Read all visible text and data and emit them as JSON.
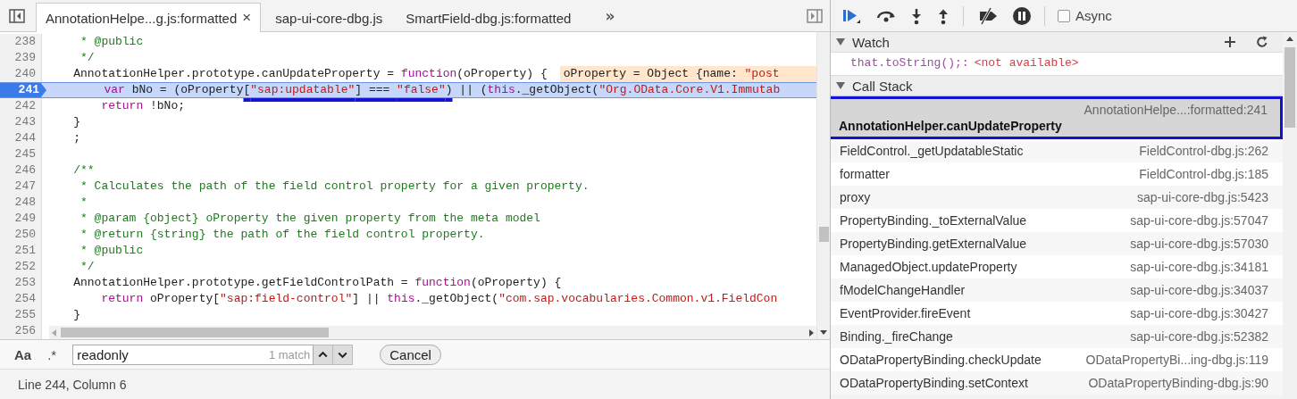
{
  "editor": {
    "tabs": [
      {
        "label": "AnnotationHelpe...g.js:formatted",
        "selected": true,
        "close": "×"
      },
      {
        "label": "sap-ui-core-dbg.js",
        "selected": false
      },
      {
        "label": "SmartField-dbg.js:formatted",
        "selected": false
      }
    ],
    "overflow": "»",
    "lines": [
      {
        "number": "238",
        "current": false,
        "tokens": [
          {
            "text": "     * @public",
            "kind": "comment"
          }
        ]
      },
      {
        "number": "239",
        "current": false,
        "tokens": [
          {
            "text": "     */",
            "kind": "comment"
          }
        ]
      },
      {
        "number": "240",
        "current": false,
        "tokens": [
          {
            "text": "    AnnotationHelper.prototype.canUpdateProperty = ",
            "kind": "plain"
          },
          {
            "text": "function",
            "kind": "keyword"
          },
          {
            "text": "(oProperty) {",
            "kind": "plain"
          }
        ],
        "inline_value": [
          {
            "text": "oProperty = Object {name: ",
            "kind": "plain"
          },
          {
            "text": "\"post",
            "kind": "string"
          }
        ]
      },
      {
        "number": "241",
        "current": true,
        "tokens": [
          {
            "text": "        var",
            "kind": "keyword",
            "marked": false
          },
          {
            "text": " bNo = (oProperty",
            "kind": "plain",
            "marked": false
          },
          {
            "text": "[",
            "kind": "plain",
            "marked": true
          },
          {
            "text": "\"sap:updatable\"",
            "kind": "string",
            "marked": true
          },
          {
            "text": "] === ",
            "kind": "plain",
            "marked": true
          },
          {
            "text": "\"false\"",
            "kind": "string",
            "marked": true
          },
          {
            "text": ")",
            "kind": "plain",
            "marked": true
          },
          {
            "text": " || (",
            "kind": "plain",
            "marked": false
          },
          {
            "text": "this",
            "kind": "keyword",
            "marked": false
          },
          {
            "text": "._getObject(",
            "kind": "plain",
            "marked": false
          },
          {
            "text": "\"Org.OData.Core.V1.Immutab",
            "kind": "string",
            "marked": false
          }
        ]
      },
      {
        "number": "242",
        "current": false,
        "tokens": [
          {
            "text": "        return",
            "kind": "keyword"
          },
          {
            "text": " !bNo;",
            "kind": "plain"
          }
        ]
      },
      {
        "number": "243",
        "current": false,
        "tokens": [
          {
            "text": "    }",
            "kind": "plain"
          }
        ]
      },
      {
        "number": "244",
        "current": false,
        "tokens": [
          {
            "text": "    ;",
            "kind": "plain"
          }
        ]
      },
      {
        "number": "245",
        "current": false
      },
      {
        "number": "246",
        "current": false,
        "tokens": [
          {
            "text": "    /**",
            "kind": "comment"
          }
        ]
      },
      {
        "number": "247",
        "current": false,
        "tokens": [
          {
            "text": "     * Calculates the path of the field control property for a given property.",
            "kind": "comment"
          }
        ]
      },
      {
        "number": "248",
        "current": false,
        "tokens": [
          {
            "text": "     *",
            "kind": "comment"
          }
        ]
      },
      {
        "number": "249",
        "current": false,
        "tokens": [
          {
            "text": "     * @param {object} oProperty the given property from the meta model",
            "kind": "comment"
          }
        ]
      },
      {
        "number": "250",
        "current": false,
        "tokens": [
          {
            "text": "     * @return {string} the path of the field control property.",
            "kind": "comment"
          }
        ]
      },
      {
        "number": "251",
        "current": false,
        "tokens": [
          {
            "text": "     * @public",
            "kind": "comment"
          }
        ]
      },
      {
        "number": "252",
        "current": false,
        "tokens": [
          {
            "text": "     */",
            "kind": "comment"
          }
        ]
      },
      {
        "number": "253",
        "current": false,
        "tokens": [
          {
            "text": "    AnnotationHelper.prototype.getFieldControlPath = ",
            "kind": "plain"
          },
          {
            "text": "function",
            "kind": "keyword"
          },
          {
            "text": "(oProperty) {",
            "kind": "plain"
          }
        ]
      },
      {
        "number": "254",
        "current": false,
        "tokens": [
          {
            "text": "        return",
            "kind": "keyword"
          },
          {
            "text": " oProperty[",
            "kind": "plain"
          },
          {
            "text": "\"sap:field-control\"",
            "kind": "string"
          },
          {
            "text": "] || ",
            "kind": "plain"
          },
          {
            "text": "this",
            "kind": "keyword"
          },
          {
            "text": "._getObject(",
            "kind": "plain"
          },
          {
            "text": "\"com.sap.vocabularies.Common.v1.FieldCon",
            "kind": "string"
          }
        ]
      },
      {
        "number": "255",
        "current": false,
        "tokens": [
          {
            "text": "    }",
            "kind": "plain"
          }
        ]
      },
      {
        "number": "256",
        "current": false
      }
    ]
  },
  "search": {
    "case_toggle": "Aa",
    "regex_toggle": ".*",
    "value": "readonly",
    "match_count": "1 match",
    "cancel": "Cancel"
  },
  "status_bar": "Line 244, Column 6",
  "debugger": {
    "async": {
      "label": "Async",
      "checked": false
    },
    "watch": {
      "title": "Watch",
      "expanded": true,
      "expressions": [
        {
          "expression": "that.toString();:",
          "value": "<not available>"
        }
      ]
    },
    "call_stack": {
      "title": "Call Stack",
      "expanded": true,
      "frames": [
        {
          "function": "AnnotationHelper.canUpdateProperty",
          "location": "AnnotationHelpe...:formatted:241",
          "selected": true
        },
        {
          "function": "FieldControl._getUpdatableStatic",
          "location": "FieldControl-dbg.js:262",
          "selected": false
        },
        {
          "function": "formatter",
          "location": "FieldControl-dbg.js:185",
          "selected": false
        },
        {
          "function": "proxy",
          "location": "sap-ui-core-dbg.js:5423",
          "selected": false
        },
        {
          "function": "PropertyBinding._toExternalValue",
          "location": "sap-ui-core-dbg.js:57047",
          "selected": false
        },
        {
          "function": "PropertyBinding.getExternalValue",
          "location": "sap-ui-core-dbg.js:57030",
          "selected": false
        },
        {
          "function": "ManagedObject.updateProperty",
          "location": "sap-ui-core-dbg.js:34181",
          "selected": false
        },
        {
          "function": "fModelChangeHandler",
          "location": "sap-ui-core-dbg.js:34037",
          "selected": false
        },
        {
          "function": "EventProvider.fireEvent",
          "location": "sap-ui-core-dbg.js:30427",
          "selected": false
        },
        {
          "function": "Binding._fireChange",
          "location": "sap-ui-core-dbg.js:52382",
          "selected": false
        },
        {
          "function": "ODataPropertyBinding.checkUpdate",
          "location": "ODataPropertyBi...ing-dbg.js:119",
          "selected": false
        },
        {
          "function": "ODataPropertyBinding.setContext",
          "location": "ODataPropertyBinding-dbg.js:90",
          "selected": false
        }
      ]
    }
  }
}
